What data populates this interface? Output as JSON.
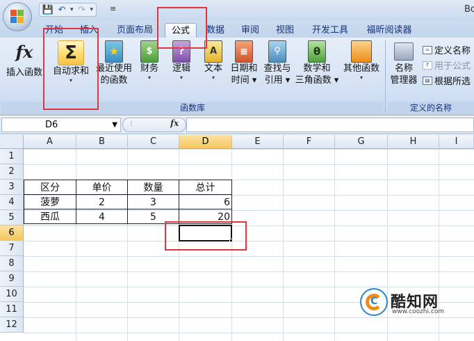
{
  "title_bar": {
    "title": "Bo"
  },
  "tabs": [
    {
      "label": "开始"
    },
    {
      "label": "插入"
    },
    {
      "label": "页面布局"
    },
    {
      "label": "公式"
    },
    {
      "label": "数据"
    },
    {
      "label": "审阅"
    },
    {
      "label": "视图"
    },
    {
      "label": "开发工具"
    },
    {
      "label": "福昕阅读器"
    }
  ],
  "active_tab": "公式",
  "ribbon": {
    "insert_function": "插入函数",
    "autosum": {
      "line1": "自动求和",
      "arrow": "▾"
    },
    "recent": {
      "line1": "最近使用",
      "line2": "的函数"
    },
    "financial": {
      "line1": "财务"
    },
    "logical": {
      "line1": "逻辑"
    },
    "text": {
      "line1": "文本"
    },
    "datetime": {
      "line1": "日期和",
      "line2": "时间"
    },
    "lookup": {
      "line1": "查找与",
      "line2": "引用"
    },
    "math": {
      "line1": "数学和",
      "line2": "三角函数"
    },
    "more": {
      "line1": "其他函数"
    },
    "name_manager": {
      "line1": "名称",
      "line2": "管理器"
    },
    "define_name": "定义名称",
    "use_in_formula": "用于公式",
    "create_from_selection": "根据所选",
    "group_function_library": "函数库",
    "group_defined_names": "定义的名称"
  },
  "formula_bar": {
    "name_box": "D6",
    "fx": "fx",
    "formula": ""
  },
  "columns": [
    "A",
    "B",
    "C",
    "D",
    "E",
    "F",
    "G",
    "H",
    "I"
  ],
  "rows": [
    "1",
    "2",
    "3",
    "4",
    "5",
    "6",
    "7",
    "8",
    "9",
    "10",
    "11",
    "12"
  ],
  "table": {
    "headers": [
      "区分",
      "单价",
      "数量",
      "总计"
    ],
    "row1": [
      "菠萝",
      "2",
      "3",
      "6"
    ],
    "row2": [
      "西瓜",
      "4",
      "5",
      "20"
    ]
  },
  "selected_cell": "D6",
  "watermark": {
    "name": "酷知网",
    "url": "www.coozhi.com"
  },
  "colors": {
    "annotation": "#e0353f",
    "selection_header": "#f6c65c",
    "ribbon": "#d3e1f3"
  }
}
